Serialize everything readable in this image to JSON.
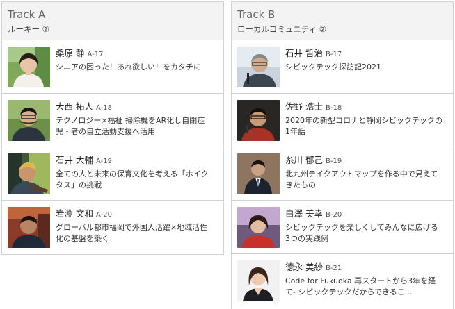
{
  "tracks": [
    {
      "title": "Track A",
      "subtitle": "ルーキー ②",
      "sessions": [
        {
          "name": "桑原 静",
          "code": "A-17",
          "title": "シニアの困った！あれ欲しい！をカタチに",
          "photo": "speaker-photo-kuwabara"
        },
        {
          "name": "大西 拓人",
          "code": "A-18",
          "title": "テクノロジー×福祉 掃除機をAR化し自閉症児・者の自立活動支援へ活用",
          "photo": "speaker-photo-onishi"
        },
        {
          "name": "石井 大輔",
          "code": "A-19",
          "title": "全ての人と未来の保育文化を考える「ホイクタス」の挑戦",
          "photo": "speaker-photo-ishii-daisuke"
        },
        {
          "name": "岩淵 文和",
          "code": "A-20",
          "title": "グローバル都市福岡で外国人活躍×地域活性化の基盤を築く",
          "photo": "speaker-photo-iwabuchi"
        }
      ]
    },
    {
      "title": "Track B",
      "subtitle": "ローカルコミュニティ ②",
      "sessions": [
        {
          "name": "石井 哲治",
          "code": "B-17",
          "title": "シビックテック探訪記2021",
          "photo": "speaker-photo-ishii-tetsuji"
        },
        {
          "name": "佐野 浩士",
          "code": "B-18",
          "title": "2020年の新型コロナと静岡シビックテックの1年話",
          "photo": "speaker-photo-sano"
        },
        {
          "name": "糸川 郁己",
          "code": "B-19",
          "title": "北九州テイクアウトマップを作る中で見えてきたもの",
          "photo": "speaker-photo-itokawa"
        },
        {
          "name": "白澤 美幸",
          "code": "B-20",
          "title": "シビックテックを楽しくしてみんなに広げる3つの実践例",
          "photo": "speaker-photo-shirasawa"
        },
        {
          "name": "徳永 美紗",
          "code": "B-21",
          "title": "Code for Fukuoka 再スタートから3年を経て- シビックテックだからできるこ...",
          "photo": "speaker-photo-tokunaga"
        }
      ]
    }
  ]
}
